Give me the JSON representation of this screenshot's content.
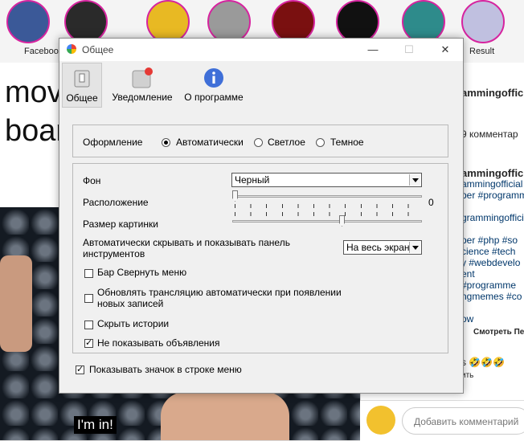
{
  "background": {
    "stories": [
      {
        "label": "Facebook"
      },
      {
        "label": ""
      },
      {
        "label": ""
      },
      {
        "label": ""
      },
      {
        "label": ""
      },
      {
        "label": ""
      },
      {
        "label": ""
      },
      {
        "label": "Result"
      }
    ],
    "post_text_line1": "move",
    "post_text_line2": "board",
    "video_caption": "I'm in!",
    "right_panel": {
      "username_header": "ammingofficial",
      "comments_count": "9 комментар",
      "username": "ammingofficial",
      "line1": "ammingofficial and",
      "line2": "per #programm",
      "line3": "grammingofficia",
      "line4": "per #php #so",
      "line5": "cience #tech",
      "line6": "y #webdevelo",
      "line7": "ent",
      "line8": "#programme",
      "line9": "ngmemes #co",
      "line10": "ow",
      "see_more": "Смотреть Пе",
      "likes_line": "s 🤣🤣🤣",
      "reply": "ить",
      "add_comment_placeholder": "Добавить комментарий"
    }
  },
  "dialog": {
    "title": "Общее",
    "window_buttons": {
      "minimize": "—",
      "maximize": "☐",
      "close": "✕"
    },
    "toolbar": [
      {
        "label": "Общее",
        "icon": "switch-icon",
        "active": true
      },
      {
        "label": "Уведомление",
        "icon": "notification-badge-icon",
        "active": false
      },
      {
        "label": "О программе",
        "icon": "info-icon",
        "active": false
      }
    ],
    "appearance": {
      "label": "Оформление",
      "options": [
        {
          "label": "Автоматически",
          "selected": true
        },
        {
          "label": "Светлое",
          "selected": false
        },
        {
          "label": "Темное",
          "selected": false
        }
      ]
    },
    "settings": {
      "background_label": "Фон",
      "background_value": "Черный",
      "position_label": "Расположение",
      "position_value": "0",
      "position_level": 0,
      "image_size_label": "Размер картинки",
      "image_size_level": 0.58,
      "autohide_label": "Автоматически скрывать и показывать панель инструментов",
      "autohide_value": "На весь экран",
      "checkboxes": [
        {
          "label": "Бар Свернуть меню",
          "checked": false
        },
        {
          "label": "Обновлять трансляцию автоматически при появлении новых записей",
          "checked": false
        },
        {
          "label": "Скрыть истории",
          "checked": false
        },
        {
          "label": "Не показывать объявления",
          "checked": true
        }
      ]
    },
    "menubar_checkbox": {
      "label": "Показывать значок в строке меню",
      "checked": true
    }
  }
}
